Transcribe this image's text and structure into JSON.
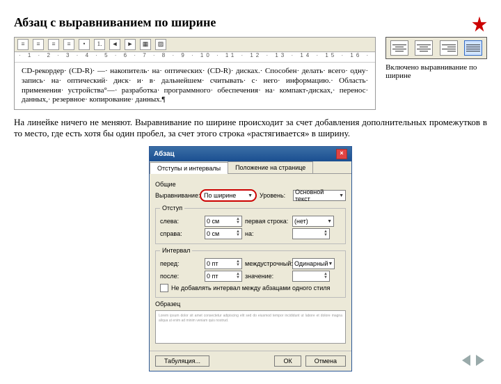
{
  "heading": "Абзац с выравниванием по ширине",
  "badge_name": "star-badge",
  "word_snippet": {
    "toolbar_icons": [
      "align-left-icon",
      "align-center-icon",
      "align-right-icon",
      "justify-icon",
      "bullets-icon",
      "numbering-icon",
      "indent-dec-icon",
      "indent-inc-icon",
      "border-icon",
      "fill-icon"
    ],
    "ruler_text": "· 1 · 2 · 3 · 4 · 5 · 6 · 7 · 8 · 9 · 10 · 11 · 12 · 13 · 14 · 15 · 16 ·",
    "paragraph": "CD-рекордер· (CD-R)· —· накопитель· на· оптических· (CD-R)· дисках.· Способен· делать· всего· одну· запись· на· оптический· диск· и· в· дальнейшем· считывать· с· него· информацию.· Область· применения· устройства°—· разработка· программного· обеспечения· на· компакт-дисках,· перенос· данных,· резервное· копирование· данных.¶"
  },
  "align_toolbar": {
    "buttons": [
      "align-left",
      "align-center",
      "align-right",
      "align-justify"
    ],
    "pressed_index": 3,
    "caption": "Включено выравнивание по ширине"
  },
  "body_text": "На линейке ничего не меняют. Выравнивание по ширине происходит за счет добавления дополнительных промежутков в то место, где есть хотя бы один пробел, за счет этого строка «растягивается» в ширину.",
  "dialog": {
    "title": "Абзац",
    "tabs": [
      "Отступы и интервалы",
      "Положение на странице"
    ],
    "active_tab": 0,
    "section_general": "Общие",
    "label_align": "Выравнивание:",
    "align_value": "По ширине",
    "label_level": "Уровень:",
    "level_value": "Основной текст",
    "section_indent": "Отступ",
    "label_left": "слева:",
    "left_value": "0 см",
    "label_right": "справа:",
    "right_value": "0 см",
    "label_first": "первая строка:",
    "first_value": "(нет)",
    "label_by1": "на:",
    "by1_value": "",
    "section_spacing": "Интервал",
    "label_before": "перед:",
    "before_value": "0 пт",
    "label_after": "после:",
    "after_value": "0 пт",
    "label_line": "междустрочный:",
    "line_value": "Одинарный",
    "label_by2": "значение:",
    "by2_value": "",
    "checkbox": "Не добавлять интервал между абзацами одного стиля",
    "preview_label": "Образец",
    "tabs_button": "Табуляция...",
    "ok": "ОК",
    "cancel": "Отмена"
  }
}
